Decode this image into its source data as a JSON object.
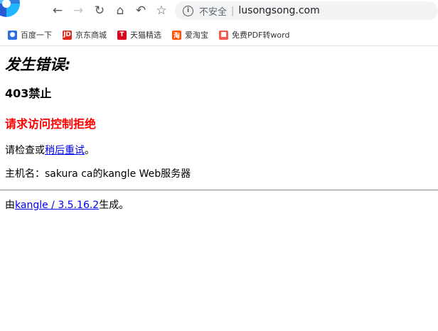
{
  "browser": {
    "address_bar": {
      "security_text": "不安全",
      "separator": "|",
      "url": "lusongsong.com"
    },
    "bookmarks": [
      {
        "label": "百度一下",
        "icon": "baidu-icon"
      },
      {
        "label": "京东商城",
        "icon": "jd-icon",
        "glyph": "JD"
      },
      {
        "label": "天猫精选",
        "icon": "tmall-icon",
        "glyph": "T"
      },
      {
        "label": "爱淘宝",
        "icon": "taobao-icon",
        "glyph": "淘"
      },
      {
        "label": "免费PDF转word",
        "icon": "pdf-icon"
      }
    ]
  },
  "page": {
    "heading": "发生错误:",
    "status": "403禁止",
    "reason": "请求访问控制拒绝",
    "check_prefix": "请检查或",
    "retry_link": "稍后重试",
    "check_suffix": "。",
    "host_line": "主机名：sakura ca的kangle Web服务器",
    "footer_prefix": "由",
    "footer_link": "kangle / 3.5.16.2",
    "footer_suffix": "生成。"
  },
  "colors": {
    "reason": "#ff0000",
    "link": "#0000ee"
  }
}
